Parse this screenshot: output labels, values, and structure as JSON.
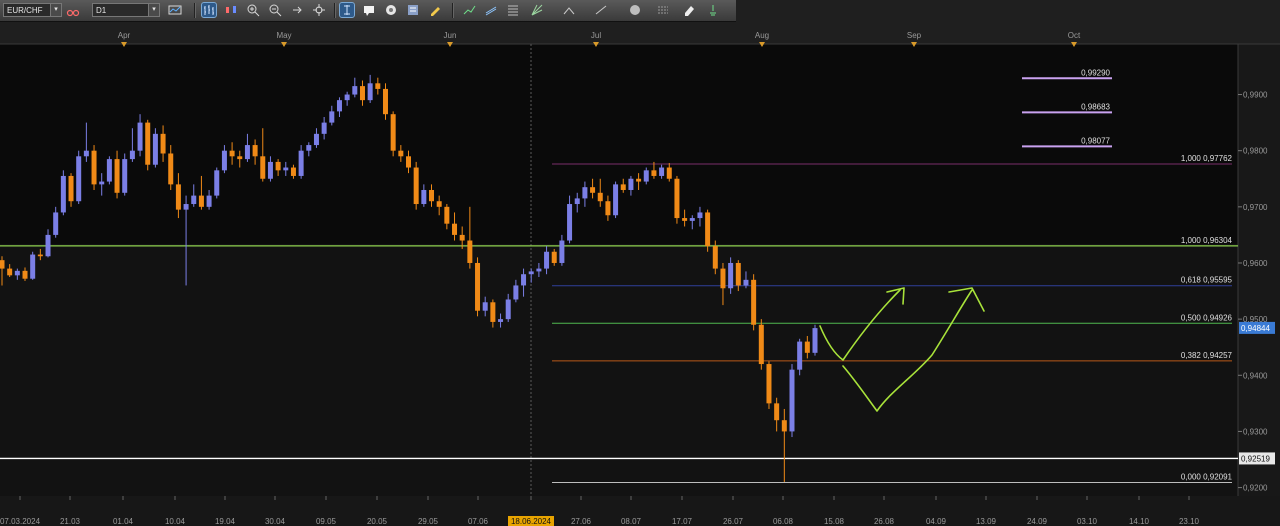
{
  "toolbar": {
    "symbol": "EUR/CHF",
    "timeframe": "D1",
    "icons": [
      "chart-type-icon",
      "link-icon",
      "bar-style-icon",
      "candle-style-icon",
      "zoom-in-icon",
      "zoom-out-icon",
      "autoscroll-icon",
      "crosshair-icon",
      "cursor-icon",
      "comment-icon",
      "template-icon",
      "indicators-icon",
      "pencil-icon",
      "trend-tools-icon",
      "channel-tools-icon",
      "fibonacci-icon",
      "gann-icon",
      "shapes-icon",
      "objects-icon",
      "eraser-icon",
      "events-icon"
    ]
  },
  "chart_data": {
    "type": "candlestick",
    "symbol": "EUR/CHF",
    "timeframe": "D1",
    "colors": {
      "up": "#7b7fe6",
      "down": "#f08a17",
      "current_price_bg": "#3a7bd5"
    },
    "y_axis": {
      "min": 0.9185,
      "max": 0.999,
      "ticks": [
        "0,9200",
        "0,9300",
        "0,9400",
        "0,9500",
        "0,9600",
        "0,9700",
        "0,9800",
        "0,9900"
      ]
    },
    "x_axis": {
      "date_labels": [
        "07.03.2024",
        "21.03",
        "01.04",
        "10.04",
        "19.04",
        "30.04",
        "09.05",
        "20.05",
        "29.05",
        "07.06",
        "18.06.2024",
        "27.06",
        "08.07",
        "17.07",
        "26.07",
        "06.08",
        "15.08",
        "26.08",
        "04.09",
        "13.09",
        "24.09",
        "03.10",
        "14.10",
        "23.10"
      ],
      "highlighted_label": "18.06.2024",
      "month_labels": [
        "Apr",
        "May",
        "Jun",
        "Jul",
        "Aug",
        "Sep",
        "Oct"
      ]
    },
    "candles": [
      [
        0.9605,
        0.9612,
        0.956,
        0.959
      ],
      [
        0.959,
        0.9598,
        0.9575,
        0.9578
      ],
      [
        0.9578,
        0.959,
        0.957,
        0.9586
      ],
      [
        0.9586,
        0.9592,
        0.9568,
        0.9572
      ],
      [
        0.9572,
        0.962,
        0.957,
        0.9615
      ],
      [
        0.9615,
        0.9625,
        0.9605,
        0.9612
      ],
      [
        0.9612,
        0.966,
        0.961,
        0.965
      ],
      [
        0.965,
        0.97,
        0.9645,
        0.969
      ],
      [
        0.969,
        0.9765,
        0.9685,
        0.9755
      ],
      [
        0.9755,
        0.976,
        0.97,
        0.971
      ],
      [
        0.971,
        0.98,
        0.9705,
        0.979
      ],
      [
        0.979,
        0.985,
        0.978,
        0.98
      ],
      [
        0.98,
        0.981,
        0.973,
        0.974
      ],
      [
        0.974,
        0.976,
        0.972,
        0.9745
      ],
      [
        0.9745,
        0.979,
        0.974,
        0.9785
      ],
      [
        0.9785,
        0.98,
        0.9715,
        0.9725
      ],
      [
        0.9725,
        0.9795,
        0.972,
        0.9785
      ],
      [
        0.9785,
        0.984,
        0.978,
        0.98
      ],
      [
        0.98,
        0.9865,
        0.979,
        0.985
      ],
      [
        0.985,
        0.9855,
        0.9765,
        0.9775
      ],
      [
        0.9775,
        0.984,
        0.977,
        0.983
      ],
      [
        0.983,
        0.9845,
        0.978,
        0.9795
      ],
      [
        0.9795,
        0.981,
        0.973,
        0.974
      ],
      [
        0.974,
        0.976,
        0.968,
        0.9695
      ],
      [
        0.9695,
        0.972,
        0.956,
        0.9705
      ],
      [
        0.9705,
        0.974,
        0.97,
        0.972
      ],
      [
        0.972,
        0.9755,
        0.9695,
        0.97
      ],
      [
        0.97,
        0.973,
        0.9695,
        0.972
      ],
      [
        0.972,
        0.977,
        0.9715,
        0.9765
      ],
      [
        0.9765,
        0.981,
        0.976,
        0.98
      ],
      [
        0.98,
        0.9815,
        0.9775,
        0.979
      ],
      [
        0.979,
        0.98,
        0.977,
        0.9785
      ],
      [
        0.9785,
        0.983,
        0.978,
        0.981
      ],
      [
        0.981,
        0.982,
        0.9775,
        0.979
      ],
      [
        0.979,
        0.984,
        0.9745,
        0.975
      ],
      [
        0.975,
        0.979,
        0.9745,
        0.978
      ],
      [
        0.978,
        0.9785,
        0.9755,
        0.9765
      ],
      [
        0.9765,
        0.978,
        0.9755,
        0.977
      ],
      [
        0.977,
        0.9775,
        0.975,
        0.9755
      ],
      [
        0.9755,
        0.981,
        0.975,
        0.98
      ],
      [
        0.98,
        0.9815,
        0.979,
        0.981
      ],
      [
        0.981,
        0.984,
        0.9805,
        0.983
      ],
      [
        0.983,
        0.986,
        0.982,
        0.985
      ],
      [
        0.985,
        0.988,
        0.9845,
        0.987
      ],
      [
        0.987,
        0.9895,
        0.986,
        0.989
      ],
      [
        0.989,
        0.9905,
        0.988,
        0.99
      ],
      [
        0.99,
        0.993,
        0.9895,
        0.9915
      ],
      [
        0.9915,
        0.9925,
        0.988,
        0.989
      ],
      [
        0.989,
        0.9935,
        0.9885,
        0.992
      ],
      [
        0.992,
        0.993,
        0.99,
        0.991
      ],
      [
        0.991,
        0.992,
        0.9855,
        0.9865
      ],
      [
        0.9865,
        0.987,
        0.979,
        0.98
      ],
      [
        0.98,
        0.981,
        0.978,
        0.979
      ],
      [
        0.979,
        0.98,
        0.976,
        0.977
      ],
      [
        0.977,
        0.978,
        0.9695,
        0.9705
      ],
      [
        0.9705,
        0.974,
        0.97,
        0.973
      ],
      [
        0.973,
        0.974,
        0.97,
        0.971
      ],
      [
        0.971,
        0.972,
        0.9685,
        0.97
      ],
      [
        0.97,
        0.9705,
        0.966,
        0.967
      ],
      [
        0.967,
        0.969,
        0.964,
        0.965
      ],
      [
        0.965,
        0.9665,
        0.9625,
        0.964
      ],
      [
        0.964,
        0.97,
        0.959,
        0.96
      ],
      [
        0.96,
        0.961,
        0.9505,
        0.9515
      ],
      [
        0.9515,
        0.954,
        0.9505,
        0.953
      ],
      [
        0.953,
        0.9535,
        0.9485,
        0.9495
      ],
      [
        0.9495,
        0.951,
        0.9485,
        0.95
      ],
      [
        0.95,
        0.9545,
        0.9495,
        0.9535
      ],
      [
        0.9535,
        0.957,
        0.953,
        0.956
      ],
      [
        0.956,
        0.959,
        0.954,
        0.958
      ],
      [
        0.958,
        0.959,
        0.9565,
        0.9585
      ],
      [
        0.9585,
        0.96,
        0.9575,
        0.959
      ],
      [
        0.959,
        0.963,
        0.958,
        0.962
      ],
      [
        0.962,
        0.9625,
        0.9595,
        0.96
      ],
      [
        0.96,
        0.965,
        0.9595,
        0.964
      ],
      [
        0.964,
        0.972,
        0.9635,
        0.9705
      ],
      [
        0.9705,
        0.9725,
        0.969,
        0.9715
      ],
      [
        0.9715,
        0.9745,
        0.97,
        0.9735
      ],
      [
        0.9735,
        0.975,
        0.9715,
        0.9725
      ],
      [
        0.9725,
        0.975,
        0.97,
        0.971
      ],
      [
        0.971,
        0.972,
        0.9675,
        0.9685
      ],
      [
        0.9685,
        0.9745,
        0.968,
        0.974
      ],
      [
        0.974,
        0.975,
        0.9725,
        0.973
      ],
      [
        0.973,
        0.9755,
        0.972,
        0.975
      ],
      [
        0.975,
        0.976,
        0.973,
        0.9745
      ],
      [
        0.9745,
        0.977,
        0.974,
        0.9765
      ],
      [
        0.9765,
        0.978,
        0.975,
        0.9755
      ],
      [
        0.9755,
        0.9775,
        0.975,
        0.977
      ],
      [
        0.977,
        0.9778,
        0.9745,
        0.975
      ],
      [
        0.975,
        0.9755,
        0.967,
        0.968
      ],
      [
        0.968,
        0.9695,
        0.9665,
        0.9675
      ],
      [
        0.9675,
        0.9685,
        0.966,
        0.968
      ],
      [
        0.968,
        0.97,
        0.9665,
        0.969
      ],
      [
        0.969,
        0.9695,
        0.962,
        0.963
      ],
      [
        0.963,
        0.964,
        0.958,
        0.959
      ],
      [
        0.959,
        0.96,
        0.9525,
        0.9555
      ],
      [
        0.9555,
        0.961,
        0.9545,
        0.96
      ],
      [
        0.96,
        0.9605,
        0.955,
        0.956
      ],
      [
        0.956,
        0.9585,
        0.9555,
        0.957
      ],
      [
        0.957,
        0.958,
        0.948,
        0.949
      ],
      [
        0.949,
        0.95,
        0.941,
        0.942
      ],
      [
        0.942,
        0.9425,
        0.934,
        0.935
      ],
      [
        0.935,
        0.936,
        0.93,
        0.932
      ],
      [
        0.932,
        0.934,
        0.921,
        0.93
      ],
      [
        0.93,
        0.942,
        0.929,
        0.941
      ],
      [
        0.941,
        0.9465,
        0.94,
        0.946
      ],
      [
        0.946,
        0.947,
        0.943,
        0.944
      ],
      [
        0.944,
        0.949,
        0.9435,
        0.9484
      ]
    ],
    "horizontal_lines": [
      {
        "label": "",
        "price": 0.92519,
        "color": "#ffffff"
      },
      {
        "label": "1,000 0,96304",
        "price": 0.96304,
        "color": "#8fd14f"
      }
    ],
    "fib_levels": [
      {
        "label": "1,000 0,97762",
        "price": 0.97762,
        "color": "#7a2e6a"
      },
      {
        "label": "0,618 0,95595",
        "price": 0.95595,
        "color": "#2f3f9a"
      },
      {
        "label": "0,500 0,94926",
        "price": 0.94926,
        "color": "#4fb84f"
      },
      {
        "label": "0,382 0,94257",
        "price": 0.94257,
        "color": "#b85a1a"
      },
      {
        "label": "0,000 0,92091",
        "price": 0.92091,
        "color": "#bdbdbd"
      }
    ],
    "extension_levels": [
      {
        "label": "0,99290",
        "price": 0.9929
      },
      {
        "label": "0,98683",
        "price": 0.98683
      },
      {
        "label": "0,98077",
        "price": 0.98077
      }
    ],
    "price_labels": [
      {
        "label": "0,94844",
        "price": 0.94844,
        "bg": "#3a7bd5"
      },
      {
        "label": "0,92519",
        "price": 0.92519,
        "bg": "#e8e8e8"
      }
    ],
    "annotations": "green hand-drawn projection arrows"
  }
}
